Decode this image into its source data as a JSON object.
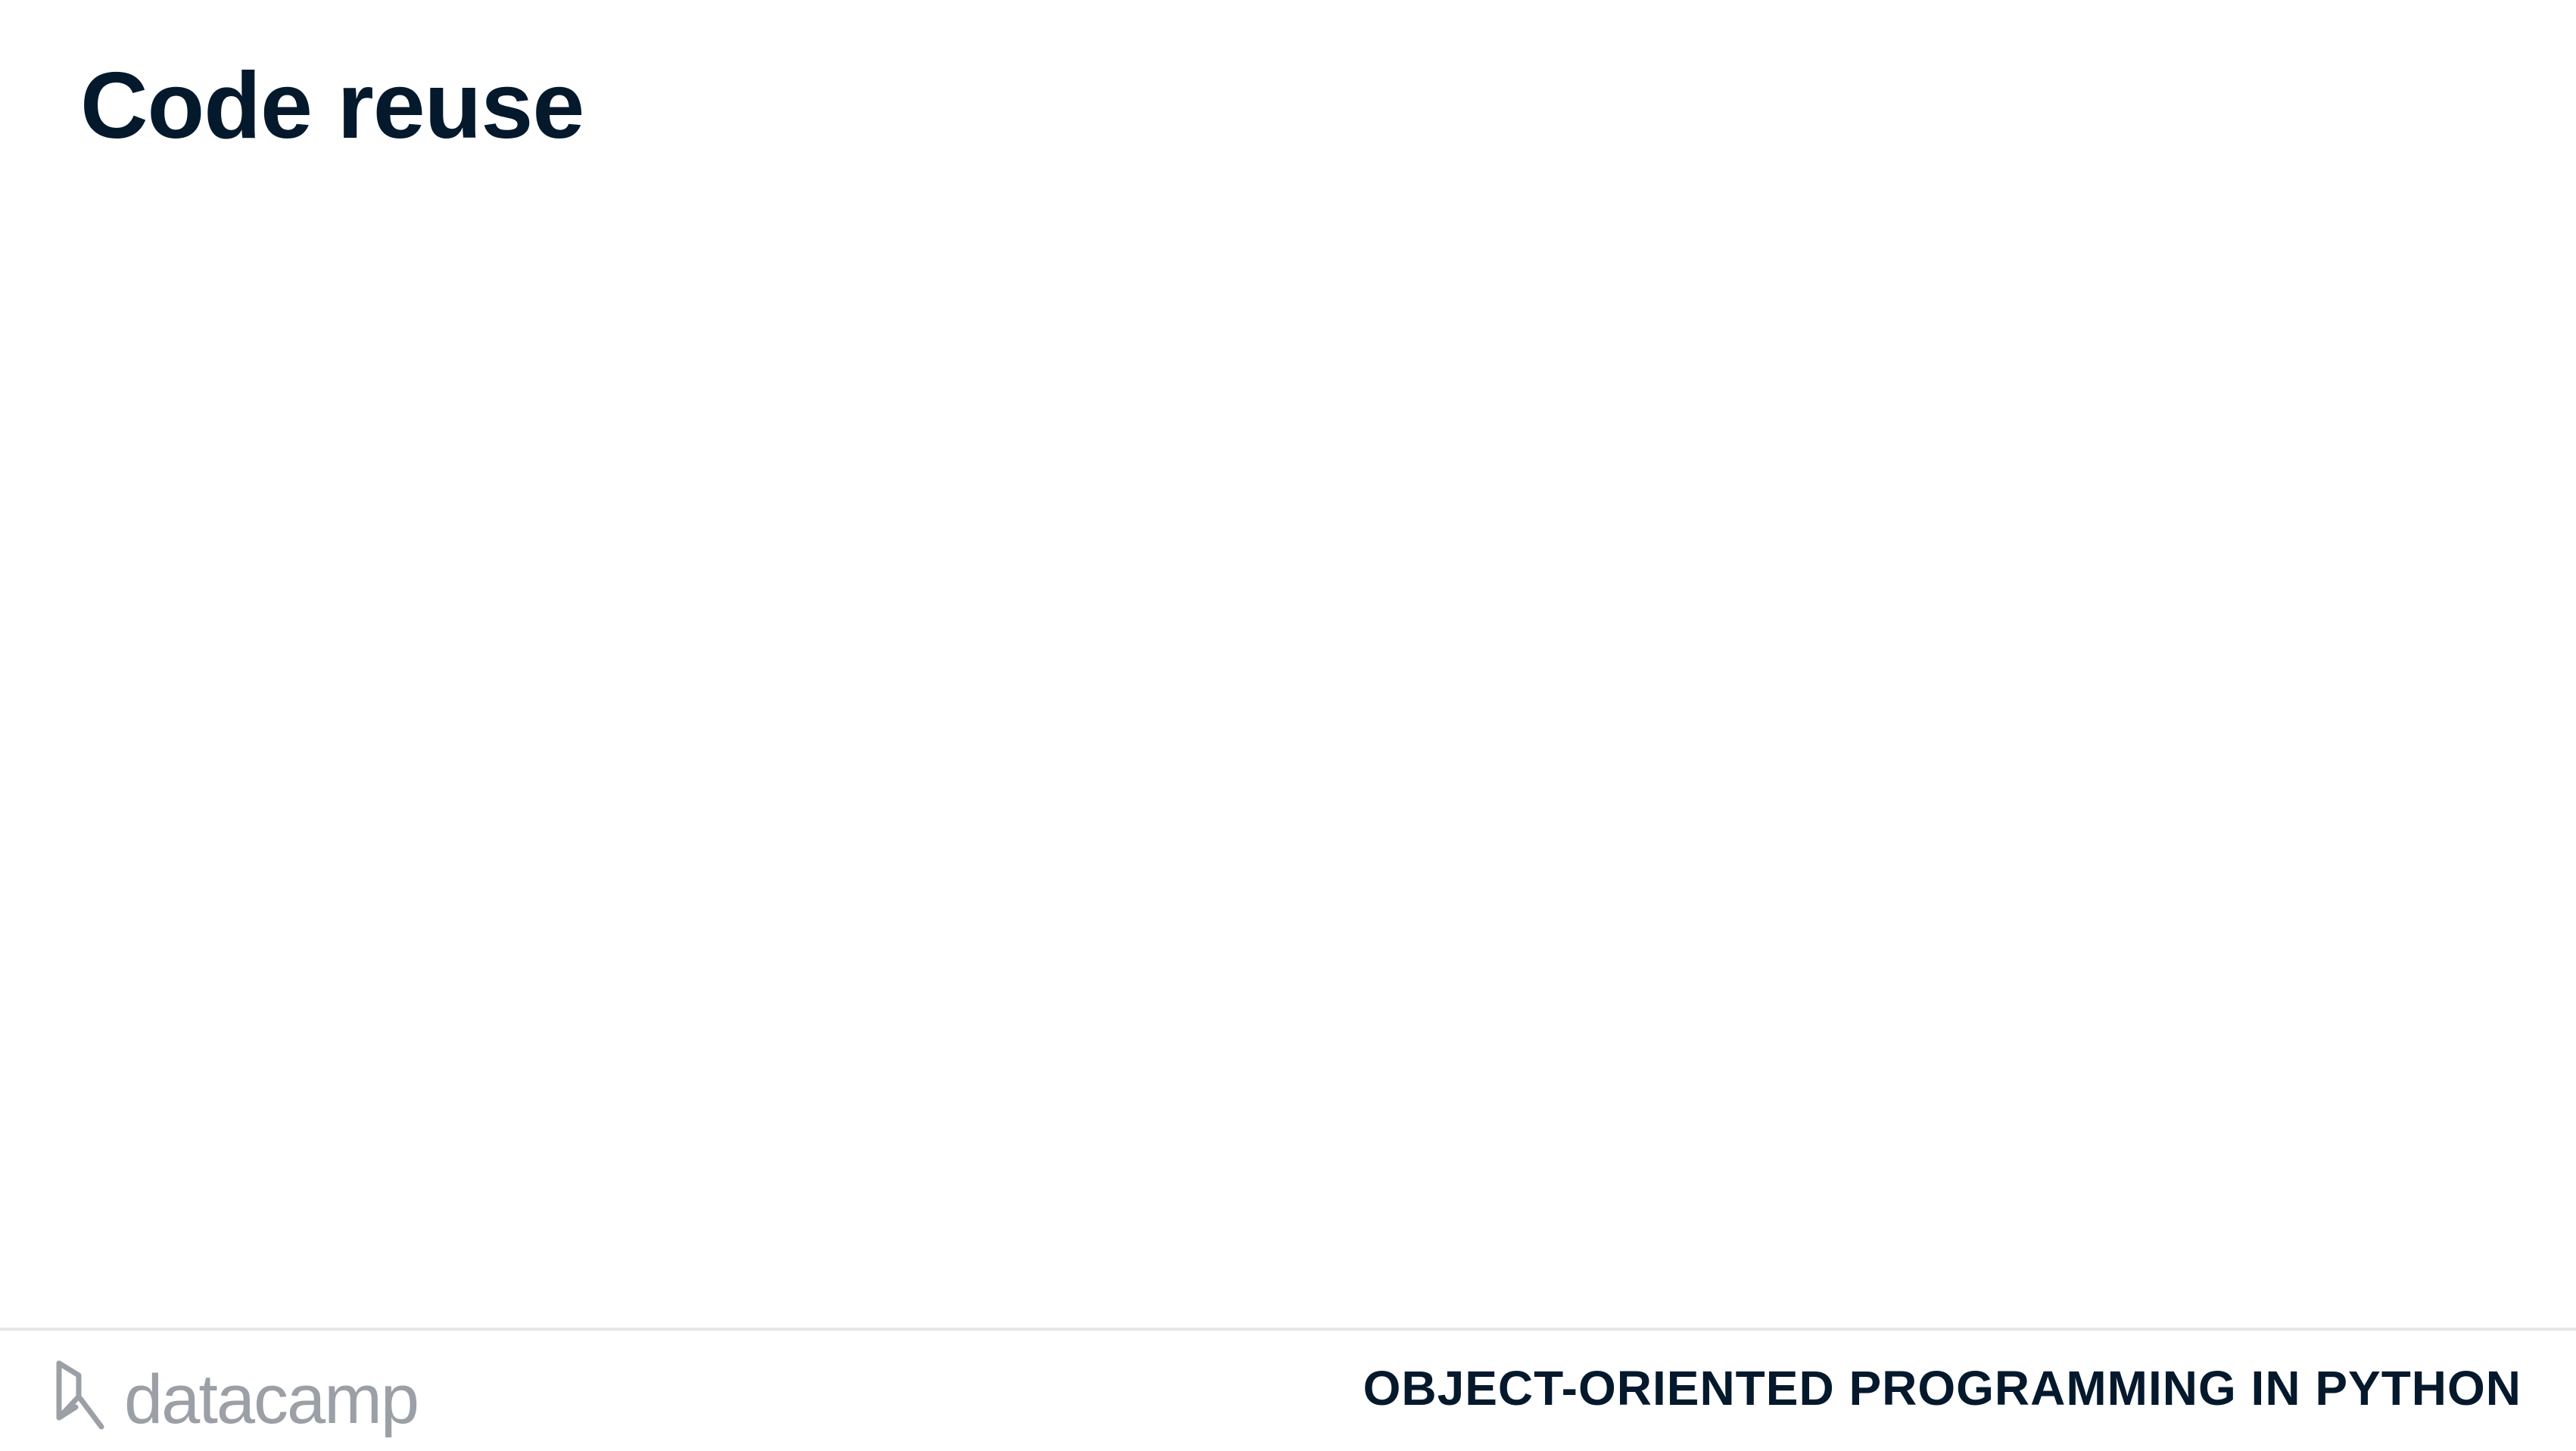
{
  "slide": {
    "title": "Code reuse"
  },
  "footer": {
    "logo_text": "datacamp",
    "logo_icon": "datacamp-logo-icon",
    "course_name": "OBJECT-ORIENTED PROGRAMMING IN PYTHON"
  },
  "colors": {
    "title": "#05192d",
    "logo": "#9aa0a6",
    "divider": "#e6e6e6",
    "background": "#ffffff"
  }
}
